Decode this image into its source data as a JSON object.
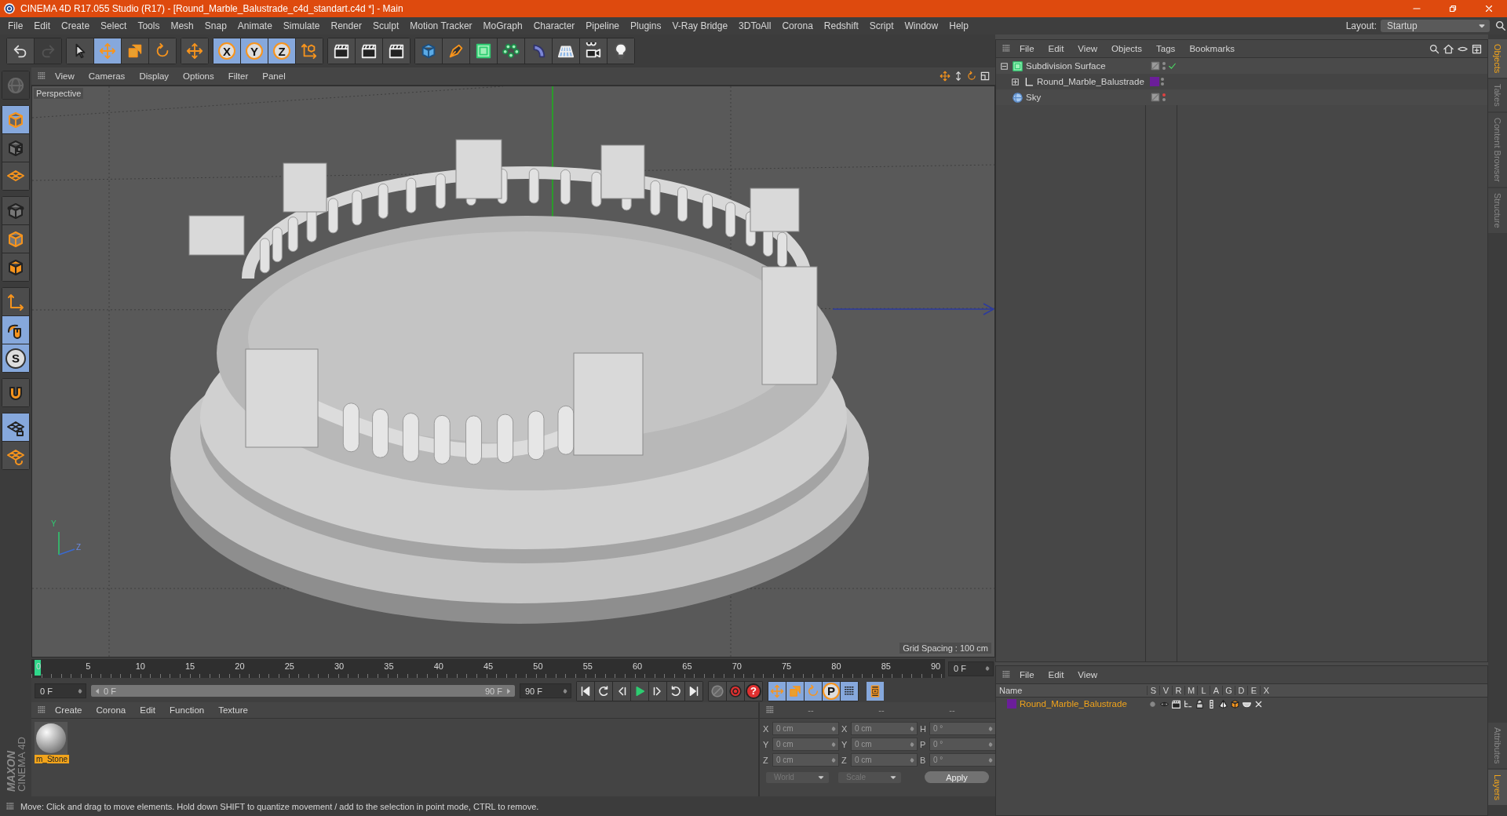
{
  "window": {
    "title": "CINEMA 4D R17.055 Studio (R17) - [Round_Marble_Balustrade_c4d_standart.c4d *] - Main"
  },
  "menu": [
    "File",
    "Edit",
    "Create",
    "Select",
    "Tools",
    "Mesh",
    "Snap",
    "Animate",
    "Simulate",
    "Render",
    "Sculpt",
    "Motion Tracker",
    "MoGraph",
    "Character",
    "Pipeline",
    "Plugins",
    "V-Ray Bridge",
    "3DToAll",
    "Corona",
    "Redshift",
    "Script",
    "Window",
    "Help"
  ],
  "layout": {
    "label": "Layout:",
    "value": "Startup"
  },
  "toolbar": [
    {
      "buttons": [
        {
          "kind": "undo",
          "selected": false,
          "disabled": false
        },
        {
          "kind": "redo",
          "selected": false,
          "disabled": true
        }
      ]
    },
    {
      "buttons": [
        {
          "kind": "cursor",
          "selected": false,
          "disabled": false
        },
        {
          "kind": "move",
          "selected": true,
          "disabled": false
        },
        {
          "kind": "scale",
          "selected": false,
          "disabled": false
        },
        {
          "kind": "rotate",
          "selected": false,
          "disabled": false
        }
      ]
    },
    {
      "buttons": [
        {
          "kind": "move",
          "selected": false,
          "disabled": false
        }
      ]
    },
    {
      "buttons": [
        {
          "kind": "letter",
          "label": "X",
          "selected": true,
          "disabled": false
        },
        {
          "kind": "letter",
          "label": "Y",
          "selected": true,
          "disabled": false
        },
        {
          "kind": "letter",
          "label": "Z",
          "selected": true,
          "disabled": false
        },
        {
          "kind": "coordinate-axes",
          "selected": false,
          "disabled": false
        }
      ]
    },
    {
      "buttons": [
        {
          "kind": "clapperboard",
          "selected": false,
          "disabled": false
        },
        {
          "kind": "clapperboard",
          "selected": false,
          "disabled": false
        },
        {
          "kind": "clapperboard",
          "selected": false,
          "disabled": false
        }
      ]
    },
    {
      "buttons": [
        {
          "kind": "cube",
          "selected": false,
          "disabled": false
        },
        {
          "kind": "pen",
          "selected": false,
          "disabled": false
        },
        {
          "kind": "cube-cage",
          "selected": false,
          "disabled": false
        },
        {
          "kind": "cluster",
          "selected": false,
          "disabled": false
        },
        {
          "kind": "bend",
          "selected": false,
          "disabled": false
        },
        {
          "kind": "floor-grid",
          "selected": false,
          "disabled": false
        },
        {
          "kind": "camera",
          "selected": false,
          "disabled": false
        },
        {
          "kind": "light-bulb",
          "selected": false,
          "disabled": false
        }
      ]
    }
  ],
  "left_tools": [
    {
      "buttons": [
        {
          "kind": "globe",
          "selected": false,
          "disabled": true
        }
      ]
    },
    {
      "buttons": [
        {
          "kind": "cube-outline",
          "selected": true,
          "disabled": false
        },
        {
          "kind": "checker-cube",
          "selected": false,
          "disabled": false
        },
        {
          "kind": "grid-plane",
          "selected": false,
          "disabled": false
        }
      ]
    },
    {
      "buttons": [
        {
          "kind": "cube-points",
          "selected": false,
          "disabled": false
        },
        {
          "kind": "cube-edges",
          "selected": false,
          "disabled": false
        },
        {
          "kind": "cube-face",
          "selected": false,
          "disabled": false
        }
      ]
    },
    {
      "buttons": [
        {
          "kind": "axis",
          "selected": false,
          "disabled": false
        },
        {
          "kind": "mouse",
          "selected": true,
          "disabled": false
        },
        {
          "kind": "letter",
          "label": "S",
          "selected": true,
          "disabled": false
        }
      ]
    },
    {
      "buttons": [
        {
          "kind": "magnet",
          "selected": false,
          "disabled": false
        }
      ]
    },
    {
      "buttons": [
        {
          "kind": "grid-lock",
          "selected": true,
          "disabled": false
        },
        {
          "kind": "grid-rotate",
          "selected": false,
          "disabled": false
        }
      ]
    }
  ],
  "logo": [
    "MAXON",
    "CINEMA 4D"
  ],
  "viewport": {
    "menu": [
      "View",
      "Cameras",
      "Display",
      "Options",
      "Filter",
      "Panel"
    ],
    "camera": "Perspective",
    "grid_spacing": "Grid Spacing : 100 cm",
    "axis_labels": [
      "Y",
      "Z"
    ]
  },
  "timeline": {
    "ticks": [
      "0",
      "5",
      "10",
      "15",
      "20",
      "25",
      "30",
      "35",
      "40",
      "45",
      "50",
      "55",
      "60",
      "65",
      "70",
      "75",
      "80",
      "85",
      "90"
    ],
    "current_frame": "0 F",
    "start": "0 F",
    "range": {
      "start": "0 F",
      "end": "90 F",
      "level": 1
    },
    "end": "90 F",
    "record_buttons": [
      {
        "kind": "key"
      },
      {
        "kind": "record"
      },
      {
        "kind": "letter",
        "label": "?"
      }
    ],
    "key_buttons": [
      {
        "kind": "move",
        "selected": true
      },
      {
        "kind": "scale",
        "selected": true
      },
      {
        "kind": "rotate",
        "selected": true
      },
      {
        "kind": "letter",
        "label": "P",
        "selected": true
      },
      {
        "kind": "dots",
        "selected": true
      }
    ]
  },
  "materials": {
    "menu": [
      "Create",
      "Corona",
      "Edit",
      "Function",
      "Texture"
    ],
    "items": [
      {
        "name": "m_Stone",
        "selected": true
      }
    ]
  },
  "coordinates": {
    "headers": [
      "--",
      "--",
      "--"
    ],
    "columns": [
      [
        {
          "axis": "X",
          "value": "0 cm"
        },
        {
          "axis": "Y",
          "value": "0 cm"
        },
        {
          "axis": "Z",
          "value": "0 cm"
        }
      ],
      [
        {
          "axis": "X",
          "value": "0 cm"
        },
        {
          "axis": "Y",
          "value": "0 cm"
        },
        {
          "axis": "Z",
          "value": "0 cm"
        }
      ],
      [
        {
          "axis": "H",
          "value": "0 °"
        },
        {
          "axis": "P",
          "value": "0 °"
        },
        {
          "axis": "B",
          "value": "0 °"
        }
      ]
    ],
    "dropdowns": [
      "World",
      "Scale"
    ],
    "apply": "Apply"
  },
  "object_manager": {
    "menu": [
      "File",
      "Edit",
      "View",
      "Objects",
      "Tags",
      "Bookmarks"
    ],
    "objects": [
      {
        "name": "Subdivision Surface",
        "kind": "generator",
        "expanded": true,
        "checked": true,
        "editor_hidden": false,
        "children": [
          {
            "name": "Round_Marble_Balustrade",
            "kind": "null",
            "expanded": false,
            "checked": false,
            "editor_hidden": false,
            "color": "#6b1e9a"
          }
        ]
      },
      {
        "name": "Sky",
        "kind": "sky",
        "checked": false,
        "editor_hidden": true
      }
    ]
  },
  "layers": {
    "menu": [
      "File",
      "Edit",
      "View"
    ],
    "columns": [
      "Name",
      "S",
      "V",
      "R",
      "M",
      "L",
      "A",
      "G",
      "D",
      "E",
      "X"
    ],
    "rows": [
      {
        "name": "Round_Marble_Balustrade",
        "color": "#6b1e9a"
      }
    ]
  },
  "side_tabs": {
    "top": [
      {
        "label": "Objects",
        "selected": true
      },
      {
        "label": "Takes",
        "selected": false
      },
      {
        "label": "Content Browser",
        "selected": false
      },
      {
        "label": "Structure",
        "selected": false
      }
    ],
    "bottom": [
      {
        "label": "Attributes",
        "selected": false
      },
      {
        "label": "Layers",
        "selected": true
      }
    ]
  },
  "status": "Move: Click and drag to move elements. Hold down SHIFT to quantize movement / add to the selection in point mode, CTRL to remove."
}
